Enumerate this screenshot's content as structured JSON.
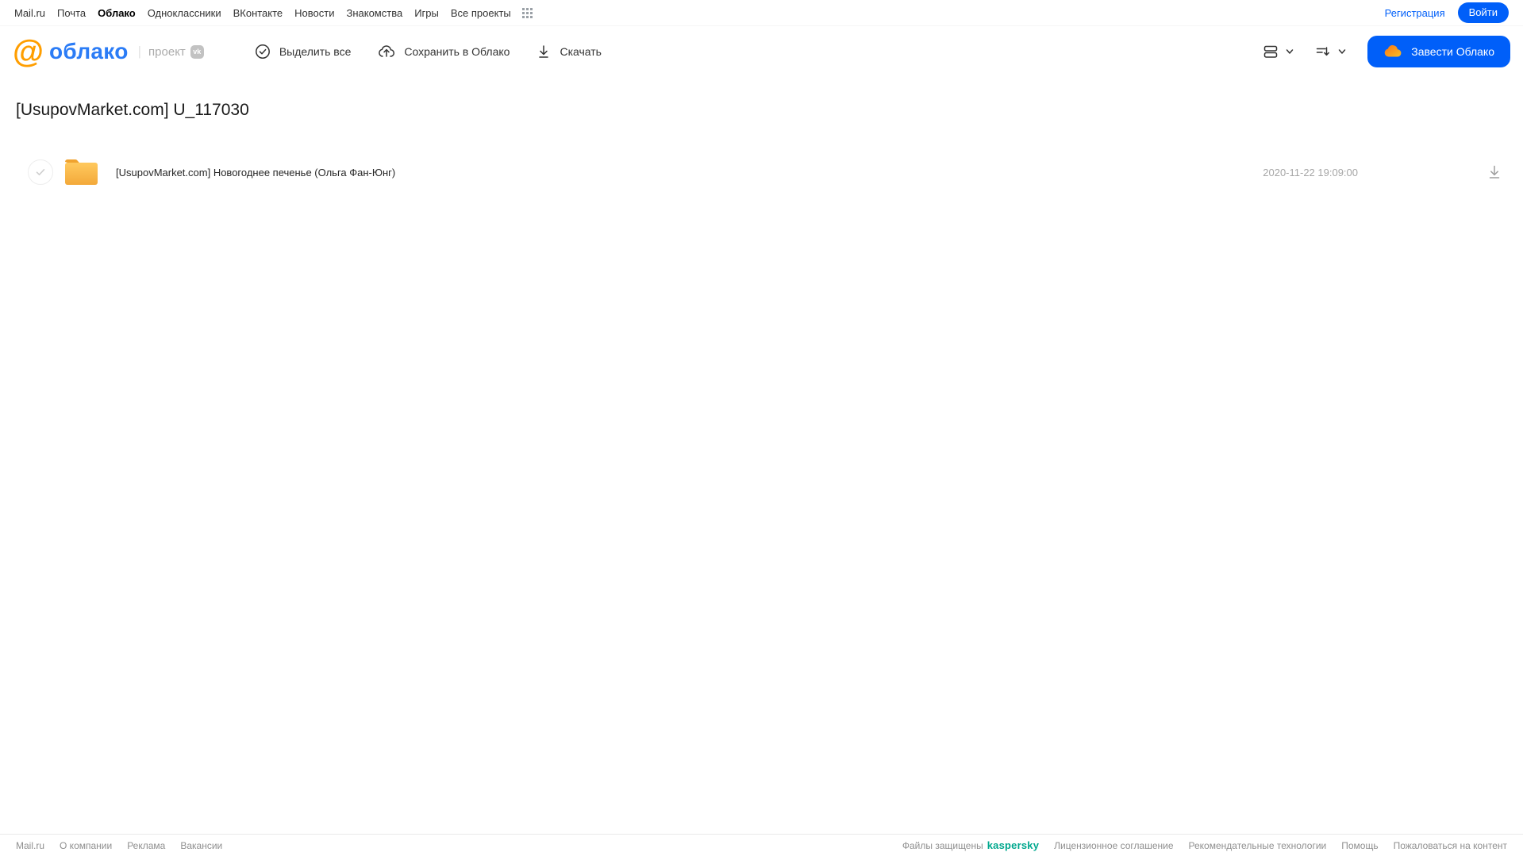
{
  "topnav": {
    "items": [
      "Mail.ru",
      "Почта",
      "Облако",
      "Одноклассники",
      "ВКонтакте",
      "Новости",
      "Знакомства",
      "Игры",
      "Все проекты"
    ],
    "active_item": "Облако",
    "registration_label": "Регистрация",
    "login_label": "Войти"
  },
  "header": {
    "logo_at": "@",
    "logo_word": "облако",
    "divider": "|",
    "project_label": "проект",
    "vk_badge": "vk",
    "toolbar": {
      "select_all_label": "Выделить все",
      "save_to_cloud_label": "Сохранить в Облако",
      "download_label": "Скачать"
    },
    "create_cloud_label": "Завести Облако"
  },
  "content": {
    "title": "[UsupovMarket.com] U_117030",
    "files": [
      {
        "type": "folder",
        "name": "[UsupovMarket.com] Новогоднее печенье (Ольга Фан-Юнг)",
        "date": "2020-11-22 19:09:00"
      }
    ]
  },
  "footer": {
    "left_links": [
      "Mail.ru",
      "О компании",
      "Реклама",
      "Вакансии"
    ],
    "protected_label": "Файлы защищены",
    "kaspersky_label": "kaspersky",
    "right_links": [
      "Лицензионное соглашение",
      "Рекомендательные технологии",
      "Помощь",
      "Пожаловаться на контент"
    ]
  },
  "icons": {
    "apps_grid": "3x3-dots-grid",
    "select_all": "check-in-circle",
    "save_to_cloud": "cloud-with-up-arrow",
    "download": "arrow-down-with-bar",
    "view_mode": "stacked-rows",
    "sort": "lines-with-down-arrow",
    "chevron": "chevron-down",
    "cloud_brand": "orange-cloud",
    "folder": "yellow-folder",
    "row_checkbox": "gray-check-circle"
  },
  "colors": {
    "accent_blue": "#005ff9",
    "logo_blue": "#2b7cf6",
    "logo_orange": "#ff9e00",
    "folder_yellow_top": "#ffc95e",
    "folder_yellow_bottom": "#f3a93a",
    "kaspersky_green": "#00a88e",
    "muted_gray": "#8f8f8f"
  }
}
